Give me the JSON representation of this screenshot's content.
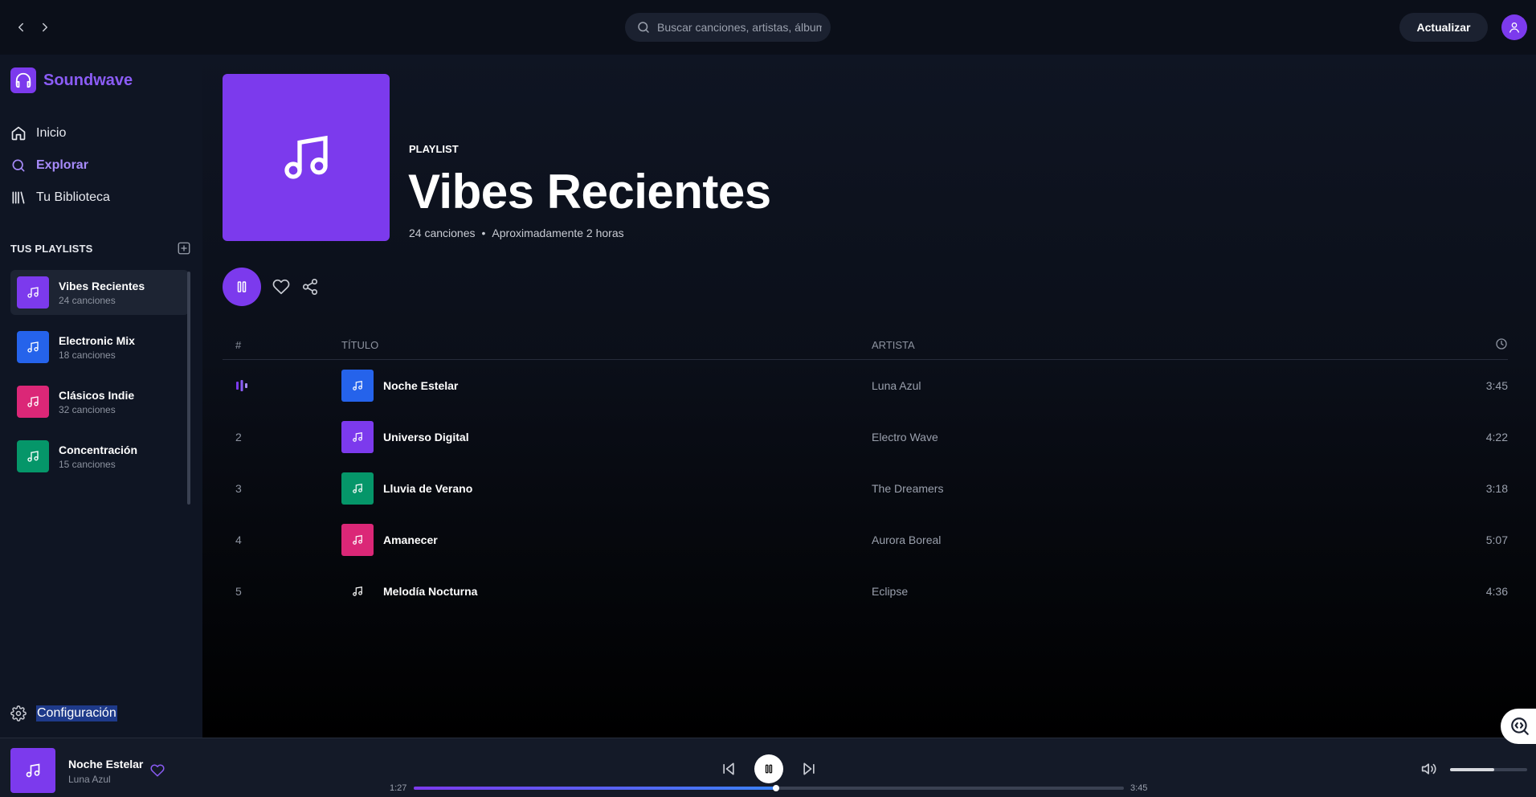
{
  "topbar": {
    "search_placeholder": "Buscar canciones, artistas, álbum",
    "upgrade_label": "Actualizar"
  },
  "sidebar": {
    "app_name": "Soundwave",
    "nav": [
      {
        "label": "Inicio",
        "icon": "home-icon"
      },
      {
        "label": "Explorar",
        "icon": "search-icon",
        "active": true
      },
      {
        "label": "Tu Biblioteca",
        "icon": "library-icon"
      }
    ],
    "playlists_title": "TUS PLAYLISTS",
    "playlists": [
      {
        "name": "Vibes Recientes",
        "count": "24 canciones",
        "color": "#7c3aed",
        "active": true
      },
      {
        "name": "Electronic Mix",
        "count": "18 canciones",
        "color": "#2563eb"
      },
      {
        "name": "Clásicos Indie",
        "count": "32 canciones",
        "color": "#db2777"
      },
      {
        "name": "Concentración",
        "count": "15 canciones",
        "color": "#059669"
      }
    ],
    "settings_label": "Configuración"
  },
  "playlist": {
    "type_label": "PLAYLIST",
    "title": "Vibes Recientes",
    "song_count": "24 canciones",
    "duration": "Aproximadamente 2 horas",
    "cover_color": "#7c3aed"
  },
  "table": {
    "headers": {
      "num": "#",
      "title": "TÍTULO",
      "artist": "ARTISTA",
      "duration_icon": "clock-icon"
    },
    "rows": [
      {
        "num": "",
        "playing": true,
        "title": "Noche Estelar",
        "artist": "Luna Azul",
        "duration": "3:45",
        "color": "#2563eb"
      },
      {
        "num": "2",
        "title": "Universo Digital",
        "artist": "Electro Wave",
        "duration": "4:22",
        "color": "#7c3aed"
      },
      {
        "num": "3",
        "title": "Lluvia de Verano",
        "artist": "The Dreamers",
        "duration": "3:18",
        "color": "#059669"
      },
      {
        "num": "4",
        "title": "Amanecer",
        "artist": "Aurora Boreal",
        "duration": "5:07",
        "color": "#db2777"
      },
      {
        "num": "5",
        "title": "Melodía Nocturna",
        "artist": "Eclipse",
        "duration": "4:36",
        "color": "transparent"
      }
    ]
  },
  "player": {
    "title": "Noche Estelar",
    "artist": "Luna Azul",
    "current_time": "1:27",
    "total_time": "3:45",
    "progress_fraction": 0.51,
    "volume_fraction": 0.57
  },
  "colors": {
    "accent": "#7c3aed",
    "accent_light": "#a78bfa",
    "background": "#0b0f19",
    "sidebar": "#0f1523"
  }
}
